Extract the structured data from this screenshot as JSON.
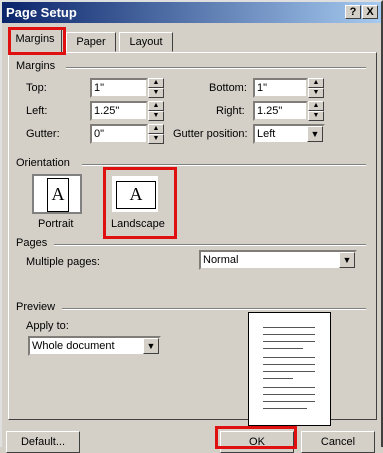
{
  "title": "Page Setup",
  "title_buttons": {
    "help": "?",
    "close": "X"
  },
  "tabs": [
    "Margins",
    "Paper",
    "Layout"
  ],
  "margins": {
    "section": "Margins",
    "top_label": "Top:",
    "top_value": "1\"",
    "bottom_label": "Bottom:",
    "bottom_value": "1\"",
    "left_label": "Left:",
    "left_value": "1.25\"",
    "right_label": "Right:",
    "right_value": "1.25\"",
    "gutter_label": "Gutter:",
    "gutter_value": "0\"",
    "gutter_pos_label": "Gutter position:",
    "gutter_pos_value": "Left"
  },
  "orientation": {
    "section": "Orientation",
    "portrait": "Portrait",
    "landscape": "Landscape",
    "glyph": "A"
  },
  "pages": {
    "section": "Pages",
    "multiple_label": "Multiple pages:",
    "multiple_value": "Normal"
  },
  "preview": {
    "section": "Preview",
    "apply_label": "Apply to:",
    "apply_value": "Whole document"
  },
  "buttons": {
    "default": "Default...",
    "ok": "OK",
    "cancel": "Cancel"
  },
  "highlight_color": "#e01010"
}
